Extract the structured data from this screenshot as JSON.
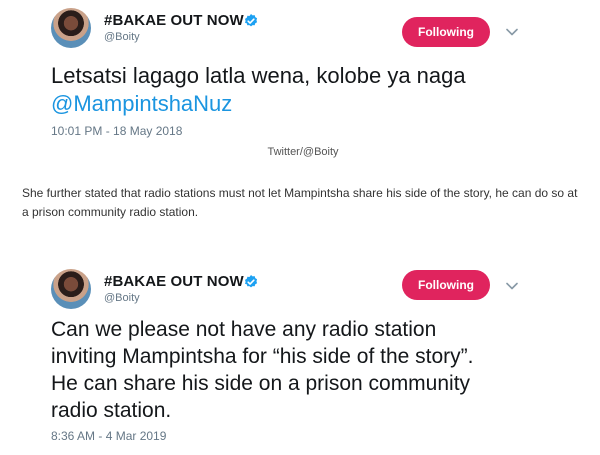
{
  "tweets": [
    {
      "display_name": "#BAKAE OUT NOW",
      "handle": "@Boity",
      "follow_label": "Following",
      "text_before": "Letsatsi lagago latla wena, kolobe ya naga",
      "mention": "@MampintshaNuz",
      "timestamp": "10:01 PM - 18 May 2018"
    },
    {
      "display_name": "#BAKAE OUT NOW",
      "handle": "@Boity",
      "follow_label": "Following",
      "text": "Can we please not have any radio station inviting Mampintsha for “his side of the story”. He can share his side on a prison community radio station.",
      "timestamp": "8:36 AM - 4 Mar 2019"
    }
  ],
  "credit": "Twitter/@Boity",
  "article": {
    "paragraph": "She further stated that radio stations must not let Mampintsha share his side of the story, he can do so at a prison community radio station."
  },
  "colors": {
    "follow_button": "#e0245e",
    "verified": "#1da1f2",
    "mention": "#1b95e0"
  },
  "icons": {
    "verified": "verified-badge-icon",
    "menu": "chevron-down-icon"
  }
}
